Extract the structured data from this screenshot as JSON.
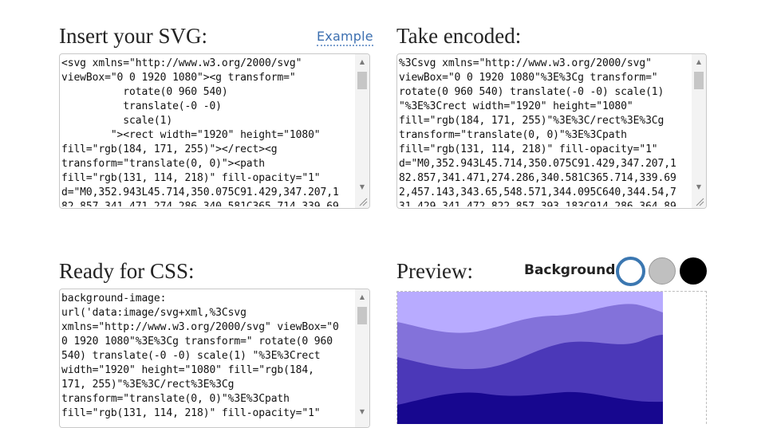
{
  "insert": {
    "heading": "Insert your SVG:",
    "example_link": "Example",
    "text": "<svg xmlns=\"http://www.w3.org/2000/svg\"\nviewBox=\"0 0 1920 1080\"><g transform=\"\n          rotate(0 960 540)\n          translate(-0 -0)\n          scale(1)\n        \"><rect width=\"1920\" height=\"1080\"\nfill=\"rgb(184, 171, 255)\"></rect><g\ntransform=\"translate(0, 0)\"><path\nfill=\"rgb(131, 114, 218)\" fill-opacity=\"1\"\nd=\"M0,352.943L45.714,350.075C91.429,347.207,1\n82.857,341.471,274.286,340.581C365.714,339.69"
  },
  "encoded": {
    "heading": "Take encoded:",
    "text": "%3Csvg xmlns=\"http://www.w3.org/2000/svg\"\nviewBox=\"0 0 1920 1080\"%3E%3Cg transform=\"\nrotate(0 960 540) translate(-0 -0) scale(1)\n\"%3E%3Crect width=\"1920\" height=\"1080\"\nfill=\"rgb(184, 171, 255)\"%3E%3C/rect%3E%3Cg\ntransform=\"translate(0, 0)\"%3E%3Cpath\nfill=\"rgb(131, 114, 218)\" fill-opacity=\"1\"\nd=\"M0,352.943L45.714,350.075C91.429,347.207,1\n82.857,341.471,274.286,340.581C365.714,339.69\n2,457.143,343.65,548.571,344.095C640,344.54,7\n31.429,341.472,822.857,393.183C914.286,364.89"
  },
  "css": {
    "heading": "Ready for CSS:",
    "text": "background-image:\nurl('data:image/svg+xml,%3Csvg\nxmlns=\"http://www.w3.org/2000/svg\" viewBox=\"0\n0 1920 1080\"%3E%3Cg transform=\" rotate(0 960\n540) translate(-0 -0) scale(1) \"%3E%3Crect\nwidth=\"1920\" height=\"1080\" fill=\"rgb(184,\n171, 255)\"%3E%3C/rect%3E%3Cg\ntransform=\"translate(0, 0)\"%3E%3Cpath\nfill=\"rgb(131, 114, 218)\" fill-opacity=\"1\""
  },
  "preview": {
    "heading": "Preview:",
    "background_label": "Background:",
    "background_options": [
      "white",
      "gray",
      "black"
    ],
    "selected_background": "white",
    "colors": {
      "base": "#b8abff",
      "wave1": "#8372da",
      "wave2": "#4b38b8",
      "wave3": "#17078f"
    }
  },
  "colors": {
    "link": "#3c6fb0",
    "selected_ring": "#3b77b1"
  }
}
